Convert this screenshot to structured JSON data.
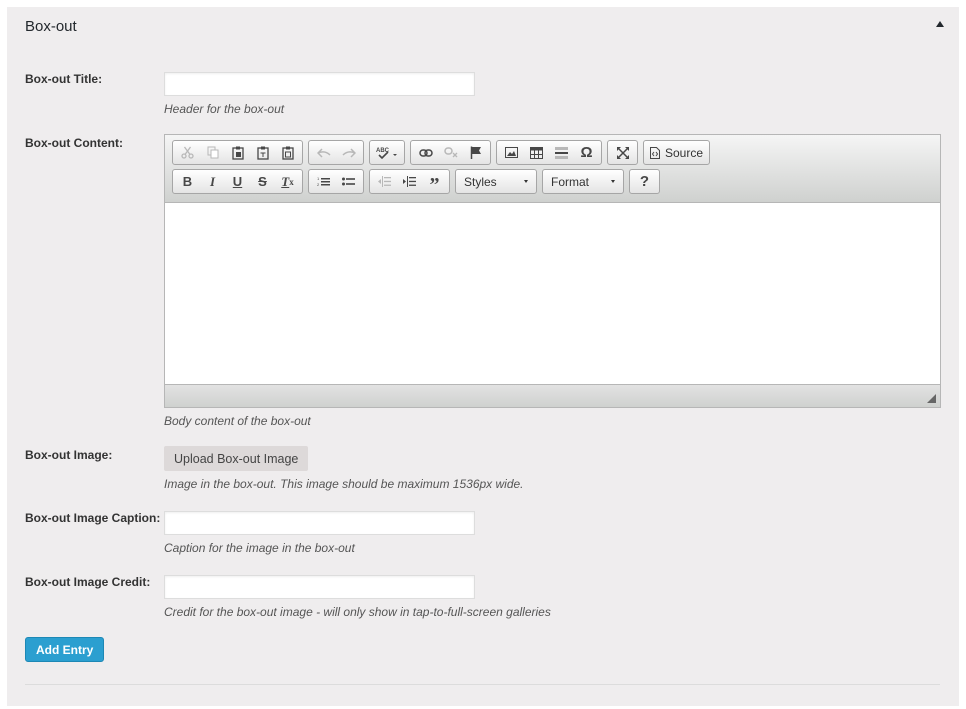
{
  "panel": {
    "title": "Box-out"
  },
  "fields": {
    "title": {
      "label": "Box-out Title:",
      "value": "",
      "description": "Header for the box-out"
    },
    "content": {
      "label": "Box-out Content:",
      "description": "Body content of the box-out"
    },
    "image": {
      "label": "Box-out Image:",
      "button": "Upload Box-out Image",
      "description": "Image in the box-out. This image should be maximum 1536px wide."
    },
    "caption": {
      "label": "Box-out Image Caption:",
      "value": "",
      "description": "Caption for the image in the box-out"
    },
    "credit": {
      "label": "Box-out Image Credit:",
      "value": "",
      "description": "Credit for the box-out image - will only show in tap-to-full-screen galleries"
    }
  },
  "editor": {
    "source_label": "Source",
    "styles_label": "Styles",
    "format_label": "Format",
    "help_label": "?",
    "toolbar_icons_row1": [
      "cut-icon",
      "copy-icon",
      "paste-icon",
      "paste-text-icon",
      "paste-word-icon",
      "undo-icon",
      "redo-icon",
      "spellcheck-icon",
      "link-icon",
      "unlink-icon",
      "anchor-icon",
      "image-icon",
      "table-icon",
      "horizontal-rule-icon",
      "special-char-icon",
      "maximize-icon",
      "source-icon"
    ],
    "toolbar_icons_row2": [
      "bold-icon",
      "italic-icon",
      "underline-icon",
      "strike-icon",
      "remove-format-icon",
      "numbered-list-icon",
      "bulleted-list-icon",
      "outdent-icon",
      "indent-icon",
      "blockquote-icon"
    ]
  },
  "actions": {
    "add_entry": "Add Entry"
  },
  "colors": {
    "panel_bg": "#efedee",
    "primary_button": "#2b9fd0"
  }
}
